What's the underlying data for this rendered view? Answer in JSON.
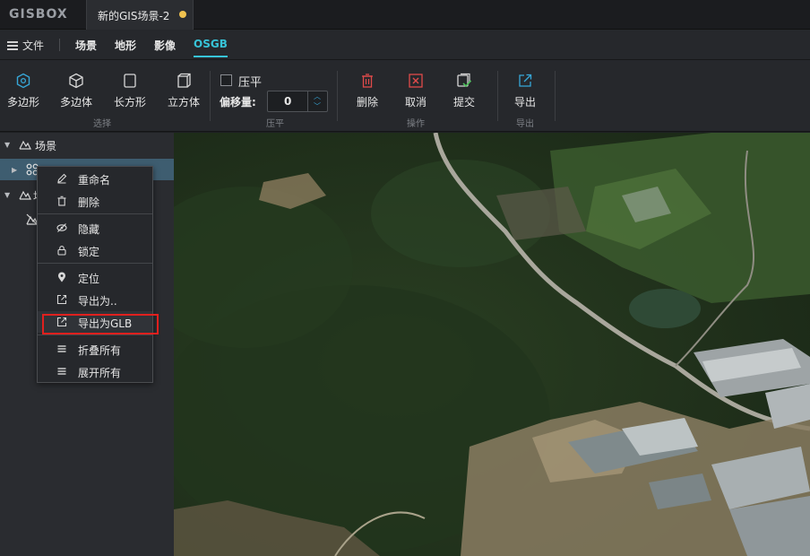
{
  "app": {
    "logo": "GISBOX"
  },
  "tabs": [
    {
      "label": "新的GIS场景-2",
      "modified": true
    }
  ],
  "menu": {
    "file_label": "文件",
    "items": [
      {
        "label": "场景"
      },
      {
        "label": "地形"
      },
      {
        "label": "影像"
      },
      {
        "label": "OSGB",
        "active": true
      }
    ],
    "accent_color": "#37c4d8"
  },
  "toolbar": {
    "select_group": {
      "label": "选择",
      "tools": [
        {
          "label": "多边形",
          "icon": "hexagon-icon"
        },
        {
          "label": "多边体",
          "icon": "cube-icon"
        },
        {
          "label": "长方形",
          "icon": "rectangle-icon"
        },
        {
          "label": "立方体",
          "icon": "box-icon"
        }
      ]
    },
    "flatten_group": {
      "label": "压平",
      "checkbox_label": "压平",
      "checkbox_checked": false,
      "offset_label": "偏移量:",
      "offset_value": "0"
    },
    "operation_group": {
      "label": "操作",
      "tools": [
        {
          "label": "删除",
          "icon": "trash-icon"
        },
        {
          "label": "取消",
          "icon": "cancel-icon"
        },
        {
          "label": "提交",
          "icon": "submit-icon"
        }
      ]
    },
    "export_group": {
      "label": "导出",
      "tools": [
        {
          "label": "导出",
          "icon": "export-icon"
        }
      ]
    }
  },
  "tree": {
    "root_label": "场景",
    "second_label": "地"
  },
  "context_menu": {
    "items": [
      {
        "label": "重命名",
        "icon": "edit-icon"
      },
      {
        "label": "删除",
        "icon": "trash-icon"
      },
      {
        "label": "隐藏",
        "icon": "eye-off-icon"
      },
      {
        "label": "锁定",
        "icon": "lock-icon"
      },
      {
        "label": "定位",
        "icon": "location-icon"
      },
      {
        "label": "导出为..",
        "icon": "export-icon"
      },
      {
        "label": "导出为GLB",
        "icon": "export-icon",
        "highlighted": true
      },
      {
        "label": "折叠所有",
        "icon": "list-icon"
      },
      {
        "label": "展开所有",
        "icon": "list-icon"
      }
    ],
    "highlight_color": "#e0201e"
  }
}
